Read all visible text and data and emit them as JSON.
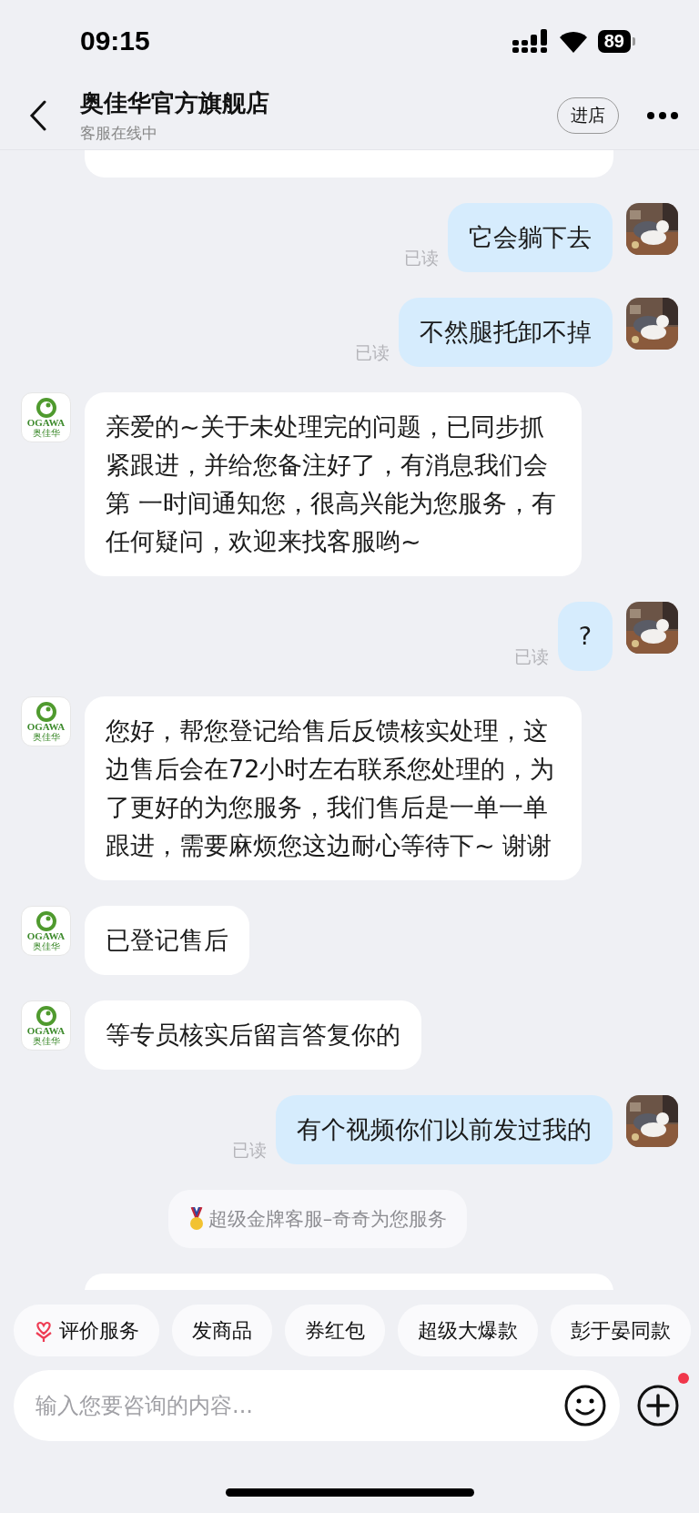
{
  "status_bar": {
    "time": "09:15",
    "battery": "89"
  },
  "header": {
    "title": "奥佳华官方旗舰店",
    "subtitle": "客服在线中",
    "shop_button": "进店"
  },
  "messages": [
    {
      "kind": "partial_top"
    },
    {
      "kind": "mine",
      "text": "它会躺下去",
      "receipt": "已读"
    },
    {
      "kind": "mine",
      "text": "不然腿托卸不掉",
      "receipt": "已读"
    },
    {
      "kind": "shop",
      "text": "亲爱的~关于未处理完的问题，已同步抓紧跟进，并给您备注好了，有消息我们会第 一时间通知您，很高兴能为您服务，有任何疑问，欢迎来找客服哟~",
      "logo_text": "OGAWA",
      "logo_subtext": "奥佳华"
    },
    {
      "kind": "mine",
      "text": "?",
      "receipt": "已读"
    },
    {
      "kind": "shop",
      "text": "您好，帮您登记给售后反馈核实处理，这边售后会在72小时左右联系您处理的，为了更好的为您服务，我们售后是一单一单跟进，需要麻烦您这边耐心等待下~ 谢谢",
      "logo_text": "OGAWA",
      "logo_subtext": "奥佳华"
    },
    {
      "kind": "shop",
      "text": "已登记售后",
      "logo_text": "OGAWA",
      "logo_subtext": "奥佳华"
    },
    {
      "kind": "shop",
      "text": "等专员核实后留言答复你的",
      "logo_text": "OGAWA",
      "logo_subtext": "奥佳华"
    },
    {
      "kind": "mine",
      "text": "有个视频你们以前发过我的",
      "receipt": "已读"
    },
    {
      "kind": "system",
      "text": "超级金牌客服–奇奇为您服务"
    },
    {
      "kind": "partial_bottom"
    }
  ],
  "quick_replies": [
    {
      "kind": "rating",
      "label": "评价服务"
    },
    {
      "kind": "plain",
      "label": "发商品"
    },
    {
      "kind": "plain",
      "label": "券红包"
    },
    {
      "kind": "plain",
      "label": "超级大爆款"
    },
    {
      "kind": "plain",
      "label": "彭于晏同款"
    }
  ],
  "composer": {
    "placeholder": "输入您要咨询的内容...",
    "plus_badge": true
  }
}
